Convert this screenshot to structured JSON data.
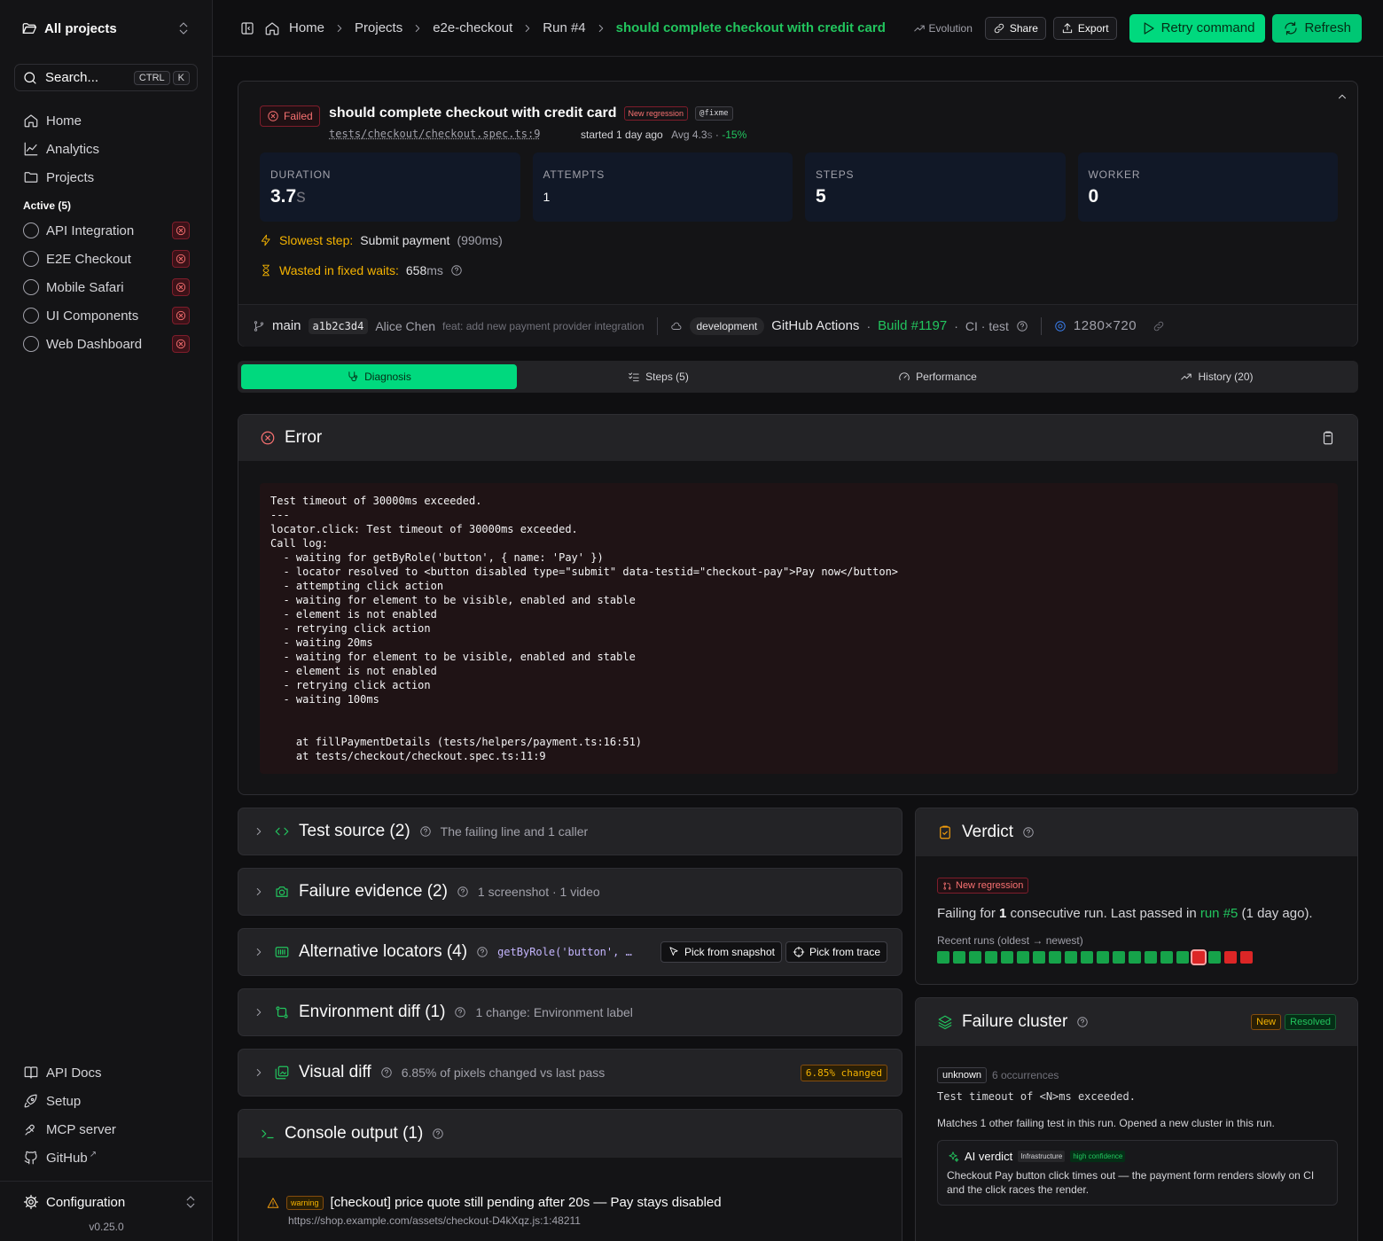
{
  "sidebar": {
    "project_switcher": "All projects",
    "search": {
      "placeholder": "Search...",
      "kbd1": "CTRL",
      "kbd2": "K"
    },
    "nav": [
      {
        "label": "Home",
        "icon": "home-icon"
      },
      {
        "label": "Analytics",
        "icon": "chart-line-icon"
      },
      {
        "label": "Projects",
        "icon": "folder-icon"
      }
    ],
    "active_section": "Active (5)",
    "projects": [
      {
        "label": "API Integration",
        "status": "failed"
      },
      {
        "label": "E2E Checkout",
        "status": "failed"
      },
      {
        "label": "Mobile Safari",
        "status": "failed"
      },
      {
        "label": "UI Components",
        "status": "failed"
      },
      {
        "label": "Web Dashboard",
        "status": "failed"
      }
    ],
    "bottom": [
      {
        "label": "API Docs",
        "icon": "book-icon"
      },
      {
        "label": "Setup",
        "icon": "rocket-icon"
      },
      {
        "label": "MCP server",
        "icon": "server-icon"
      },
      {
        "label": "GitHub",
        "icon": "github-icon",
        "external": "↗"
      }
    ],
    "configuration": "Configuration",
    "version": "v0.25.0"
  },
  "topbar": {
    "breadcrumbs": [
      "Home",
      "Projects",
      "e2e-checkout",
      "Run #4",
      "should complete checkout with credit card"
    ],
    "evolution": "Evolution",
    "share": "Share",
    "export": "Export",
    "retry": "Retry command",
    "refresh": "Refresh"
  },
  "test": {
    "status": "Failed",
    "title": "should complete checkout with credit card",
    "regression_badge": "New regression",
    "tag": "@fixme",
    "file": "tests/checkout/checkout.spec.ts:9",
    "started": "started 1 day ago",
    "avg": "Avg 4.3s",
    "avg_num": "Avg 4.3",
    "avg_unit": "s",
    "avg_sep": " · ",
    "delta": "-15%",
    "stats": [
      {
        "label": "DURATION",
        "value": "3.7",
        "unit": "s"
      },
      {
        "label": "ATTEMPTS",
        "value": "1",
        "unit": ""
      },
      {
        "label": "STEPS",
        "value": "5",
        "unit": ""
      },
      {
        "label": "WORKER",
        "value": "0",
        "unit": ""
      }
    ],
    "slowest_step": {
      "label": "Slowest step:",
      "name": "Submit payment",
      "duration": "(990ms)",
      "dur_num": "990",
      "dur_unit": "ms"
    },
    "wasted": {
      "label": "Wasted in fixed waits:",
      "value": "658",
      "unit": "ms"
    }
  },
  "meta": {
    "branch": "main",
    "commit": "a1b2c3d4",
    "author": "Alice Chen",
    "message": "feat: add new payment provider integration",
    "environment": "development",
    "ci": "GitHub Actions",
    "build": "Build #1197",
    "job": "CI · test",
    "viewport": "1280×720"
  },
  "tabs": [
    {
      "label": "Diagnosis",
      "active": true
    },
    {
      "label": "Steps (5)",
      "active": false
    },
    {
      "label": "Performance",
      "active": false
    },
    {
      "label": "History (20)",
      "active": false
    }
  ],
  "error": {
    "title": "Error",
    "log": "Test timeout of 30000ms exceeded.\n---\nlocator.click: Test timeout of 30000ms exceeded.\nCall log:\n  - waiting for getByRole('button', { name: 'Pay' })\n  - locator resolved to <button disabled type=\"submit\" data-testid=\"checkout-pay\">Pay now</button>\n  - attempting click action\n  - waiting for element to be visible, enabled and stable\n  - element is not enabled\n  - retrying click action\n  - waiting 20ms\n  - waiting for element to be visible, enabled and stable\n  - element is not enabled\n  - retrying click action\n  - waiting 100ms\n\n\n    at fillPaymentDetails (tests/helpers/payment.ts:16:51)\n    at tests/checkout/checkout.spec.ts:11:9"
  },
  "panels": {
    "test_source": {
      "title": "Test source (2)",
      "desc": "The failing line and 1 caller"
    },
    "failure_evidence": {
      "title": "Failure evidence (2)",
      "desc": "1 screenshot · 1 video"
    },
    "alt_locators": {
      "title": "Alternative locators (4)",
      "snippet": "getByRole('button', …",
      "pick_snapshot": "Pick from snapshot",
      "pick_trace": "Pick from trace"
    },
    "env_diff": {
      "title": "Environment diff (1)",
      "desc": "1 change: Environment label"
    },
    "visual_diff": {
      "title": "Visual diff",
      "desc": "6.85% of pixels changed vs last pass",
      "badge": "6.85% changed"
    },
    "console": {
      "title": "Console output (1)",
      "level": "warning",
      "message": "[checkout] price quote still pending after 20s — Pay stays disabled",
      "url": "https://shop.example.com/assets/checkout-D4kXqz.js:1:48211"
    }
  },
  "verdict": {
    "title": "Verdict",
    "badge": "New regression",
    "text_pre": "Failing for ",
    "count": "1",
    "text_mid": " consecutive run. Last passed in ",
    "link": "run #5",
    "text_post": " (1 day ago).",
    "recent_label": "Recent runs (oldest → newest)",
    "runs": [
      "pass",
      "pass",
      "pass",
      "pass",
      "pass",
      "pass",
      "pass",
      "pass",
      "pass",
      "pass",
      "pass",
      "pass",
      "pass",
      "pass",
      "pass",
      "pass",
      "fail",
      "pass",
      "fail",
      "fail"
    ],
    "highlight_index": 16
  },
  "cluster": {
    "title": "Failure cluster",
    "tag_new": "New",
    "tag_resolved": "Resolved",
    "category": "unknown",
    "occurrences": "6 occurrences",
    "message": "Test timeout of <N>ms exceeded.",
    "match": "Matches 1 other failing test in this run. Opened a new cluster in this run.",
    "ai": {
      "label": "AI verdict",
      "category": "Infrastructure",
      "confidence": "high confidence",
      "text": "Checkout Pay button click times out — the payment form renders slowly on CI and the click races the render."
    }
  },
  "colors": {
    "accent": "#00d97e",
    "fail": "#dc2626",
    "warn": "#f5b301"
  }
}
